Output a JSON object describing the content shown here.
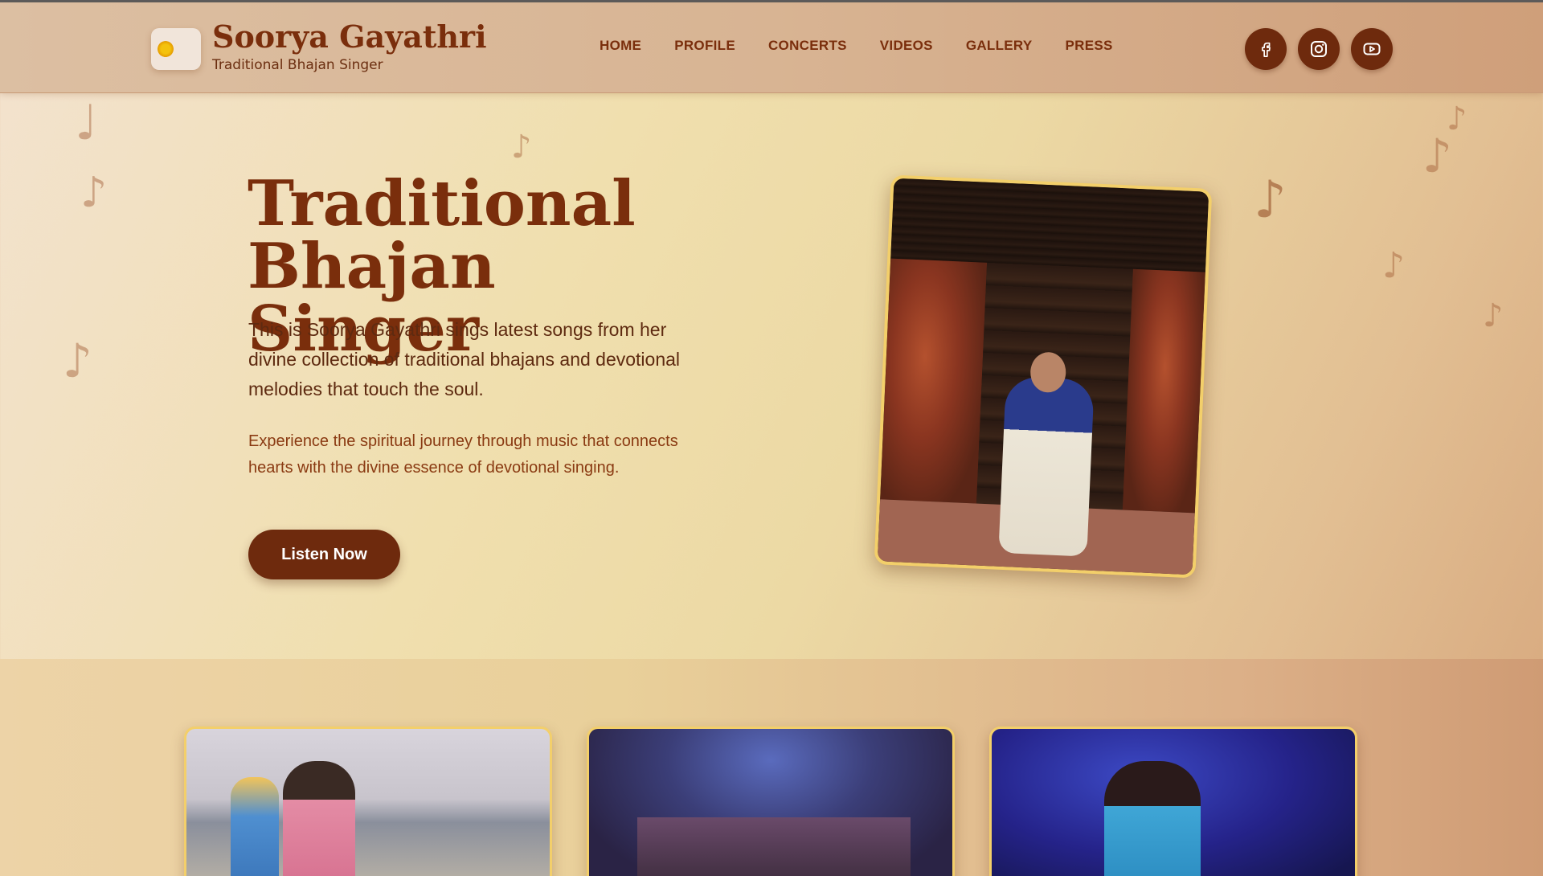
{
  "brand": {
    "title": "Soorya Gayathri",
    "subtitle": "Traditional Bhajan Singer"
  },
  "nav": {
    "items": [
      "HOME",
      "PROFILE",
      "CONCERTS",
      "VIDEOS",
      "GALLERY",
      "PRESS"
    ]
  },
  "social": {
    "icons": [
      "facebook-icon",
      "instagram-icon",
      "youtube-icon"
    ]
  },
  "hero": {
    "title_line1": "Traditional",
    "title_line2": "Bhajan Singer",
    "description": "This is Soorya Gayathri sings latest songs from her divine collection of traditional bhajans and devotional melodies that touch the soul.",
    "description2": "Experience the spiritual journey through music that connects hearts with the divine essence of devotional singing.",
    "cta_label": "Listen Now"
  },
  "colors": {
    "accent": "#6e2a0d",
    "brand_text": "#7a2e0c",
    "photo_border": "#f3cf6a"
  }
}
